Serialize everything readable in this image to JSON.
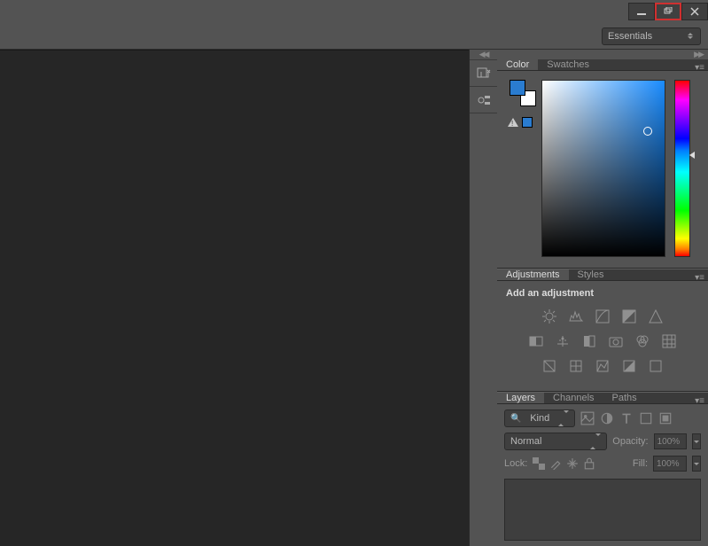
{
  "workspace": {
    "selected": "Essentials"
  },
  "colorPanel": {
    "tabs": [
      "Color",
      "Swatches"
    ],
    "activeTab": "Color"
  },
  "adjustmentsPanel": {
    "tabs": [
      "Adjustments",
      "Styles"
    ],
    "activeTab": "Adjustments",
    "hint": "Add an adjustment"
  },
  "layersPanel": {
    "tabs": [
      "Layers",
      "Channels",
      "Paths"
    ],
    "activeTab": "Layers",
    "filter": "Kind",
    "blendMode": "Normal",
    "opacityLabel": "Opacity:",
    "opacityValue": "100%",
    "lockLabel": "Lock:",
    "fillLabel": "Fill:",
    "fillValue": "100%"
  }
}
